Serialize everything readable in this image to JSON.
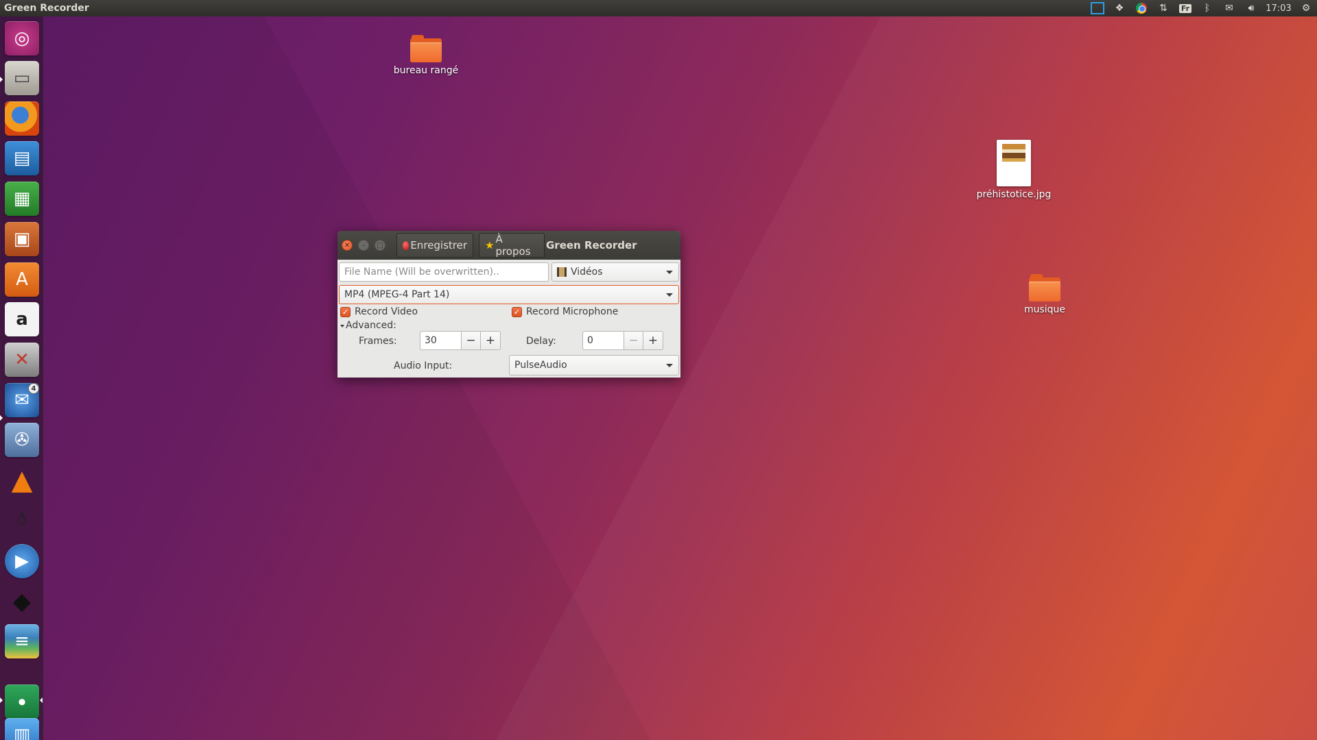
{
  "top_panel": {
    "app_title": "Green Recorder",
    "tray": {
      "screenshot_icon": "screenshot-icon",
      "dropbox_icon": "dropbox-icon",
      "chrome_icon": "chrome-icon",
      "network_icon": "network-icon",
      "keyboard_layout": "Fr",
      "bluetooth_icon": "bluetooth-icon",
      "mail_icon": "mail-icon",
      "volume_icon": "volume-icon",
      "clock": "17:03",
      "settings_icon": "gear-icon"
    }
  },
  "launcher": {
    "items": [
      {
        "name": "ubuntu-dash",
        "badge": ""
      },
      {
        "name": "files",
        "badge": ""
      },
      {
        "name": "firefox",
        "badge": ""
      },
      {
        "name": "libreoffice-writer",
        "badge": ""
      },
      {
        "name": "libreoffice-calc",
        "badge": ""
      },
      {
        "name": "libreoffice-impress",
        "badge": ""
      },
      {
        "name": "ubuntu-software",
        "badge": ""
      },
      {
        "name": "amazon",
        "badge": ""
      },
      {
        "name": "system-settings",
        "badge": ""
      },
      {
        "name": "thunderbird",
        "badge": "4"
      },
      {
        "name": "video-editor",
        "badge": ""
      },
      {
        "name": "vlc",
        "badge": ""
      },
      {
        "name": "penguin-app",
        "badge": ""
      },
      {
        "name": "media-player",
        "badge": ""
      },
      {
        "name": "inkscape",
        "badge": ""
      },
      {
        "name": "layers-app",
        "badge": ""
      },
      {
        "name": "green-recorder",
        "badge": ""
      },
      {
        "name": "workspace-switcher",
        "badge": ""
      }
    ]
  },
  "desktop": {
    "icons": [
      {
        "label": "bureau rangé",
        "type": "folder"
      },
      {
        "label": "préhistotice.jpg",
        "type": "image-file"
      },
      {
        "label": "musique",
        "type": "folder"
      }
    ]
  },
  "window": {
    "title": "Green Recorder",
    "record_button": "Enregistrer",
    "about_button": "À propos",
    "filename_placeholder": "File Name (Will be overwritten)..",
    "folder_combo": "Vidéos",
    "format_combo": "MP4 (MPEG-4 Part 14)",
    "record_video": {
      "label": "Record Video",
      "checked": true
    },
    "record_microphone": {
      "label": "Record Microphone",
      "checked": true
    },
    "advanced_label": "Advanced:",
    "frames_label": "Frames:",
    "frames_value": "30",
    "delay_label": "Delay:",
    "delay_value": "0",
    "audio_input_label": "Audio Input:",
    "audio_input_combo": "PulseAudio",
    "minus": "−",
    "plus": "+",
    "check_mark": "✓"
  },
  "colors": {
    "accent_orange": "#e2582b",
    "panel": "#3c3b37",
    "window_bg": "#e8e8e7"
  }
}
